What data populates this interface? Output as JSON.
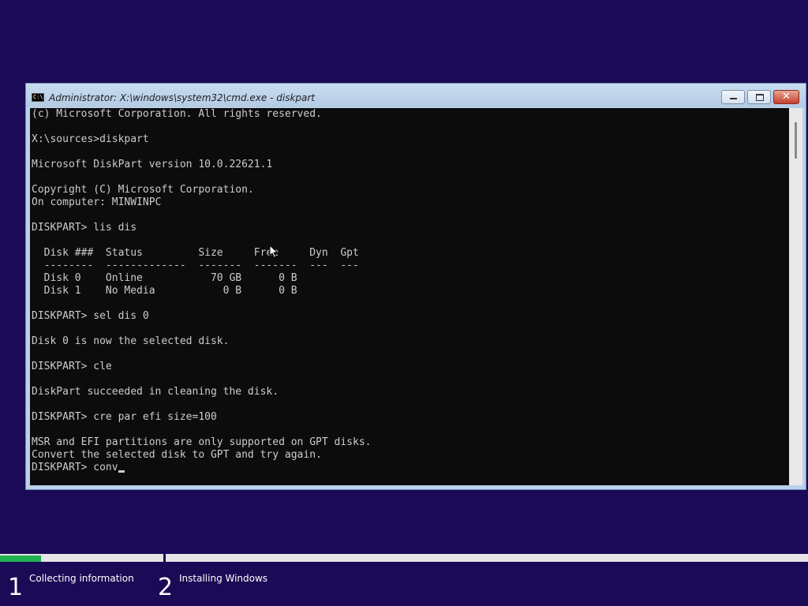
{
  "window": {
    "title": "Administrator: X:\\windows\\system32\\cmd.exe - diskpart",
    "icon": "cmd-icon",
    "icon_text": "C:\\"
  },
  "controls": {
    "minimize_icon": "minimize-icon",
    "maximize_icon": "maximize-icon",
    "close_icon": "close-icon",
    "close_glyph": "✕"
  },
  "console": {
    "lines": [
      "(c) Microsoft Corporation. All rights reserved.",
      "",
      "X:\\sources>diskpart",
      "",
      "Microsoft DiskPart version 10.0.22621.1",
      "",
      "Copyright (C) Microsoft Corporation.",
      "On computer: MINWINPC",
      "",
      "DISKPART> lis dis",
      "",
      "  Disk ###  Status         Size     Free     Dyn  Gpt",
      "  --------  -------------  -------  -------  ---  ---",
      "  Disk 0    Online           70 GB      0 B",
      "  Disk 1    No Media           0 B      0 B",
      "",
      "DISKPART> sel dis 0",
      "",
      "Disk 0 is now the selected disk.",
      "",
      "DISKPART> cle",
      "",
      "DiskPart succeeded in cleaning the disk.",
      "",
      "DISKPART> cre par efi size=100",
      "",
      "MSR and EFI partitions are only supported on GPT disks.",
      "Convert the selected disk to GPT and try again.",
      ""
    ],
    "prompt": "DISKPART> ",
    "input_value": "conv"
  },
  "setup": {
    "progress_fraction": 0.25,
    "progress_color": "#21b14f",
    "steps": [
      {
        "number": "1",
        "label": "Collecting information"
      },
      {
        "number": "2",
        "label": "Installing Windows"
      }
    ]
  },
  "colors": {
    "background": "#1b0a55",
    "console_bg": "#0c0c0c",
    "console_text": "#cccccc"
  }
}
